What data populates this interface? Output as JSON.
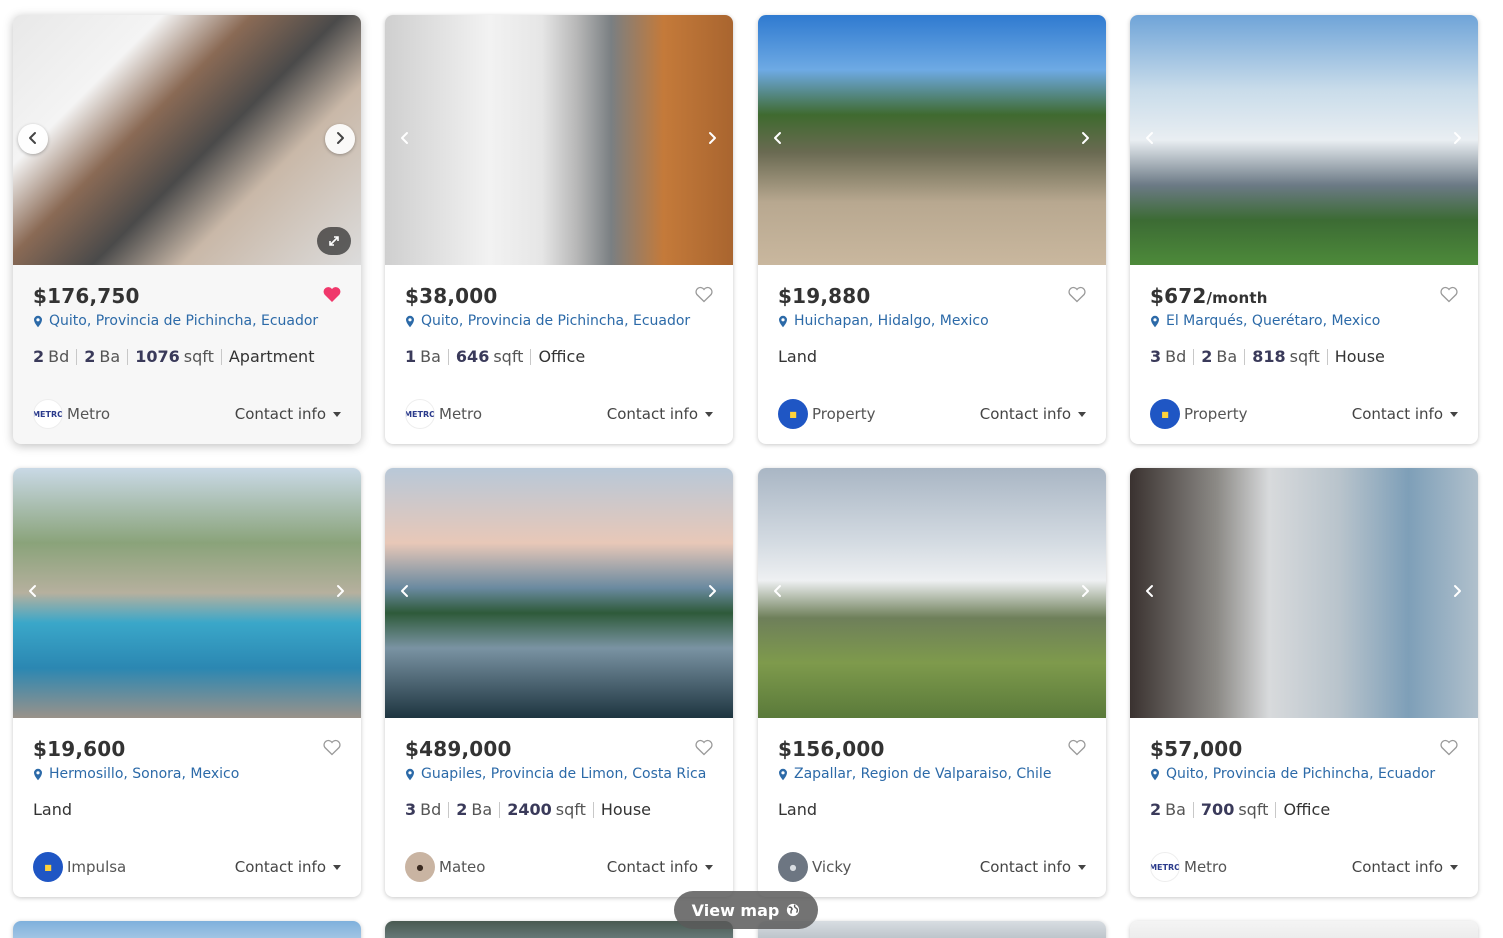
{
  "view_map": {
    "label": "View map",
    "icon": "globe-icon"
  },
  "listings": [
    {
      "price": "$176,750",
      "unit": "",
      "location": "Quito, Provincia de Pichincha, Ecuador",
      "specs": [
        {
          "n": "2",
          "u": "Bd"
        },
        {
          "n": "2",
          "u": "Ba"
        },
        {
          "n": "1076",
          "u": "sqft"
        }
      ],
      "type": "Apartment",
      "agent": "Metro",
      "contact": "Contact info",
      "favorited": true
    },
    {
      "price": "$38,000",
      "unit": "",
      "location": "Quito, Provincia de Pichincha, Ecuador",
      "specs": [
        {
          "n": "1",
          "u": "Ba"
        },
        {
          "n": "646",
          "u": "sqft"
        }
      ],
      "type": "Office",
      "agent": "Metro",
      "contact": "Contact info",
      "favorited": false
    },
    {
      "price": "$19,880",
      "unit": "",
      "location": "Huichapan, Hidalgo, Mexico",
      "specs": [],
      "type": "Land",
      "agent": "Property",
      "contact": "Contact info",
      "favorited": false
    },
    {
      "price": "$672",
      "unit": "/month",
      "location": "El Marqués, Querétaro, Mexico",
      "specs": [
        {
          "n": "3",
          "u": "Bd"
        },
        {
          "n": "2",
          "u": "Ba"
        },
        {
          "n": "818",
          "u": "sqft"
        }
      ],
      "type": "House",
      "agent": "Property",
      "contact": "Contact info",
      "favorited": false
    },
    {
      "price": "$19,600",
      "unit": "",
      "location": "Hermosillo, Sonora, Mexico",
      "specs": [],
      "type": "Land",
      "agent": "Impulsa",
      "contact": "Contact info",
      "favorited": false
    },
    {
      "price": "$489,000",
      "unit": "",
      "location": "Guapiles, Provincia de Limon, Costa Rica",
      "specs": [
        {
          "n": "3",
          "u": "Bd"
        },
        {
          "n": "2",
          "u": "Ba"
        },
        {
          "n": "2400",
          "u": "sqft"
        }
      ],
      "type": "House",
      "agent": "Mateo",
      "contact": "Contact info",
      "favorited": false
    },
    {
      "price": "$156,000",
      "unit": "",
      "location": "Zapallar, Region de Valparaiso, Chile",
      "specs": [],
      "type": "Land",
      "agent": "Vicky",
      "contact": "Contact info",
      "favorited": false
    },
    {
      "price": "$57,000",
      "unit": "",
      "location": "Quito, Provincia de Pichincha, Ecuador",
      "specs": [
        {
          "n": "2",
          "u": "Ba"
        },
        {
          "n": "700",
          "u": "sqft"
        }
      ],
      "type": "Office",
      "agent": "Metro",
      "contact": "Contact info",
      "favorited": false
    }
  ],
  "colors": {
    "favorite": "#f0386b",
    "location": "#2c6aa8",
    "price": "#333333"
  }
}
